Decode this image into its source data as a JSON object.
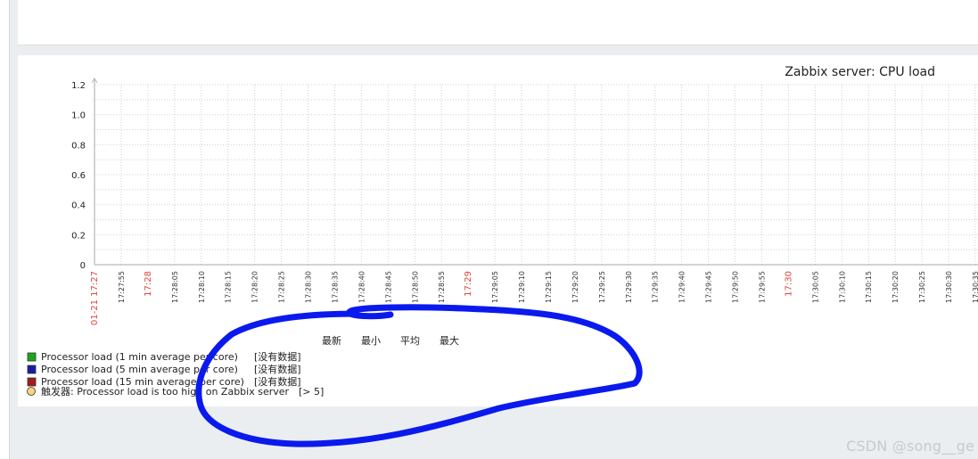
{
  "chart_data": {
    "type": "line",
    "title": "Zabbix server: CPU load",
    "xlabel": "",
    "ylabel": "",
    "ylim": [
      0,
      1.2
    ],
    "y_ticks": [
      "0",
      "0.2",
      "0.4",
      "0.6",
      "0.8",
      "1.0",
      "1.2"
    ],
    "x_ticks": [
      {
        "label": "01-21 17:27",
        "highlight": true
      },
      {
        "label": "17:27:55",
        "highlight": false
      },
      {
        "label": "17:28",
        "highlight": true
      },
      {
        "label": "17:28:05",
        "highlight": false
      },
      {
        "label": "17:28:10",
        "highlight": false
      },
      {
        "label": "17:28:15",
        "highlight": false
      },
      {
        "label": "17:28:20",
        "highlight": false
      },
      {
        "label": "17:28:25",
        "highlight": false
      },
      {
        "label": "17:28:30",
        "highlight": false
      },
      {
        "label": "17:28:35",
        "highlight": false
      },
      {
        "label": "17:28:40",
        "highlight": false
      },
      {
        "label": "17:28:45",
        "highlight": false
      },
      {
        "label": "17:28:50",
        "highlight": false
      },
      {
        "label": "17:28:55",
        "highlight": false
      },
      {
        "label": "17:29",
        "highlight": true
      },
      {
        "label": "17:29:05",
        "highlight": false
      },
      {
        "label": "17:29:10",
        "highlight": false
      },
      {
        "label": "17:29:15",
        "highlight": false
      },
      {
        "label": "17:29:20",
        "highlight": false
      },
      {
        "label": "17:29:25",
        "highlight": false
      },
      {
        "label": "17:29:30",
        "highlight": false
      },
      {
        "label": "17:29:35",
        "highlight": false
      },
      {
        "label": "17:29:40",
        "highlight": false
      },
      {
        "label": "17:29:45",
        "highlight": false
      },
      {
        "label": "17:29:50",
        "highlight": false
      },
      {
        "label": "17:29:55",
        "highlight": false
      },
      {
        "label": "17:30",
        "highlight": true
      },
      {
        "label": "17:30:05",
        "highlight": false
      },
      {
        "label": "17:30:10",
        "highlight": false
      },
      {
        "label": "17:30:15",
        "highlight": false
      },
      {
        "label": "17:30:20",
        "highlight": false
      },
      {
        "label": "17:30:25",
        "highlight": false
      },
      {
        "label": "17:30:30",
        "highlight": false
      },
      {
        "label": "17:30:35",
        "highlight": false
      }
    ],
    "grid": true,
    "legend_placement": "bottom-left",
    "legend_headers": [
      "最新",
      "最小",
      "平均",
      "最大"
    ],
    "series": [
      {
        "name": "Processor load (1 min average per core)",
        "color": "#1aa81a",
        "status": "[没有数据]",
        "values": []
      },
      {
        "name": "Processor load (5 min average per core)",
        "color": "#1a1aa8",
        "status": "[没有数据]",
        "values": []
      },
      {
        "name": "Processor load (15 min average per core)",
        "color": "#a81a1a",
        "status": "[没有数据]",
        "values": []
      }
    ],
    "trigger": {
      "label": "触发器: Processor load is too high on Zabbix server",
      "value": "[> 5]",
      "color": "#ffd37d"
    }
  },
  "watermark": "CSDN @song__ge",
  "colors": {
    "highlight_tick": "#e0433a",
    "annotation_stroke": "#0a1aee"
  }
}
